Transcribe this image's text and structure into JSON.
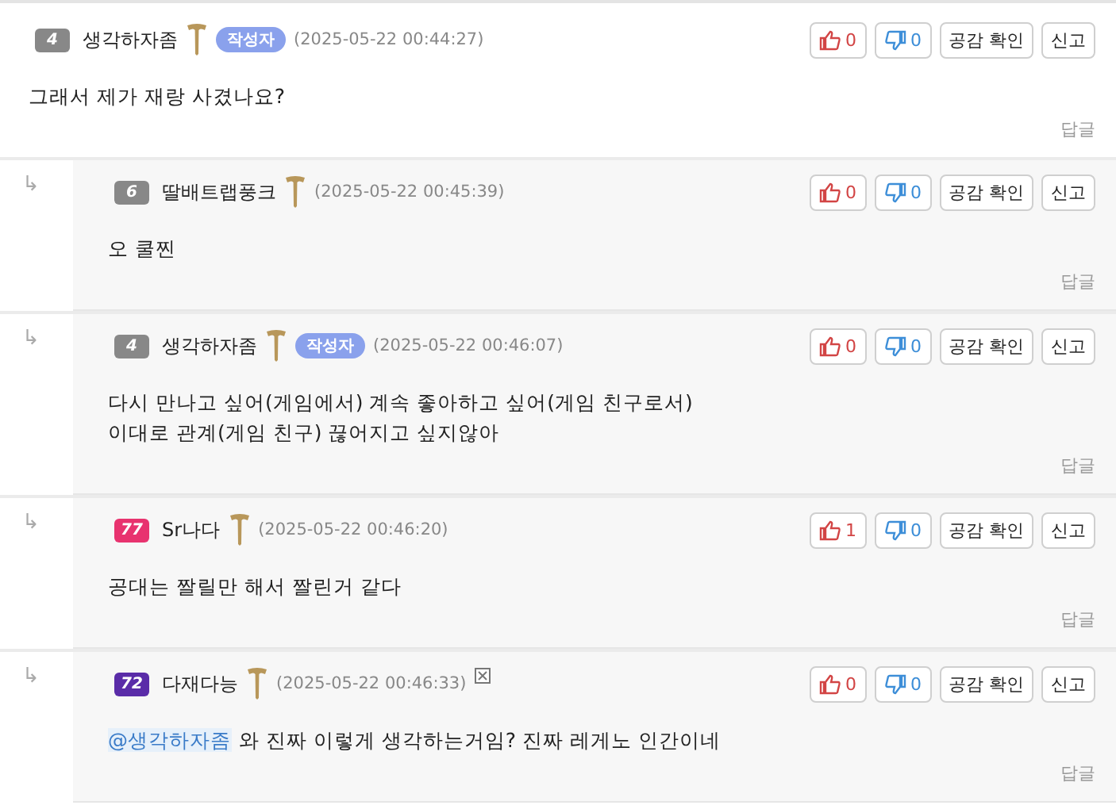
{
  "comments": [
    {
      "level": "4",
      "color": "#888888",
      "author": "생각하자좀",
      "is_writer": true,
      "writer_label": "작성자",
      "time": "(2025-05-22 00:44:27)",
      "image_icon": false,
      "lines": [
        "그래서 제가 재랑 사겼나요?"
      ],
      "likes": "0",
      "dislikes": "0",
      "check_label": "공감 확인",
      "report_label": "신고",
      "reply_label": "답글",
      "is_reply": false
    },
    {
      "level": "6",
      "color": "#888888",
      "author": "딸배트랩풍크",
      "is_writer": false,
      "time": "(2025-05-22 00:45:39)",
      "image_icon": false,
      "lines": [
        "오 쿨찐"
      ],
      "likes": "0",
      "dislikes": "0",
      "check_label": "공감 확인",
      "report_label": "신고",
      "reply_label": "답글",
      "is_reply": true,
      "reply_arrow": "↳"
    },
    {
      "level": "4",
      "color": "#888888",
      "author": "생각하자좀",
      "is_writer": true,
      "writer_label": "작성자",
      "time": "(2025-05-22 00:46:07)",
      "image_icon": false,
      "lines": [
        "다시 만나고 싶어(게임에서) 계속 좋아하고 싶어(게임 친구로서)",
        "이대로 관계(게임 친구) 끊어지고 싶지않아"
      ],
      "likes": "0",
      "dislikes": "0",
      "check_label": "공감 확인",
      "report_label": "신고",
      "reply_label": "답글",
      "is_reply": true,
      "reply_arrow": "↳"
    },
    {
      "level": "77",
      "color": "#e8336f",
      "author": "Sr나다",
      "is_writer": false,
      "time": "(2025-05-22 00:46:20)",
      "image_icon": false,
      "lines": [
        "공대는 짤릴만 해서 짤린거 같다"
      ],
      "likes": "1",
      "dislikes": "0",
      "check_label": "공감 확인",
      "report_label": "신고",
      "reply_label": "답글",
      "is_reply": true,
      "reply_arrow": "↳"
    },
    {
      "level": "72",
      "color": "#5a2ca8",
      "author": "다재다능",
      "is_writer": false,
      "time": "(2025-05-22 00:46:33)",
      "image_icon": true,
      "mention": "@생각하자좀",
      "lines": [
        "와 진짜 이렇게 생각하는거임? 진짜 레게노 인간이네"
      ],
      "likes": "0",
      "dislikes": "0",
      "check_label": "공감 확인",
      "report_label": "신고",
      "reply_label": "답글",
      "is_reply": true,
      "reply_arrow": "↳"
    }
  ]
}
